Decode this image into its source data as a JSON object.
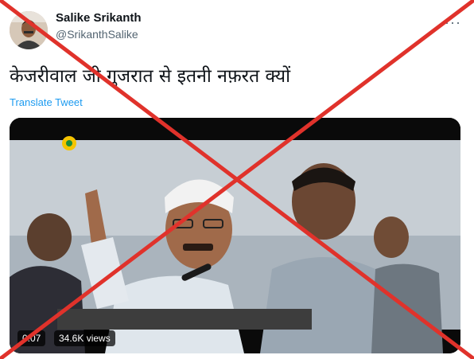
{
  "tweet": {
    "author_name": "Salike Srikanth",
    "author_handle": "@SrikanthSalike",
    "more_icon": "more-dots-icon",
    "text": "केजरीवाल जी गुजरात से इतनी नफ़रत क्यों",
    "translate_label": "Translate Tweet"
  },
  "video": {
    "time": "0:07",
    "views": "34.6K views"
  },
  "colors": {
    "link": "#1d9bf0",
    "cross": "#e0322b"
  }
}
